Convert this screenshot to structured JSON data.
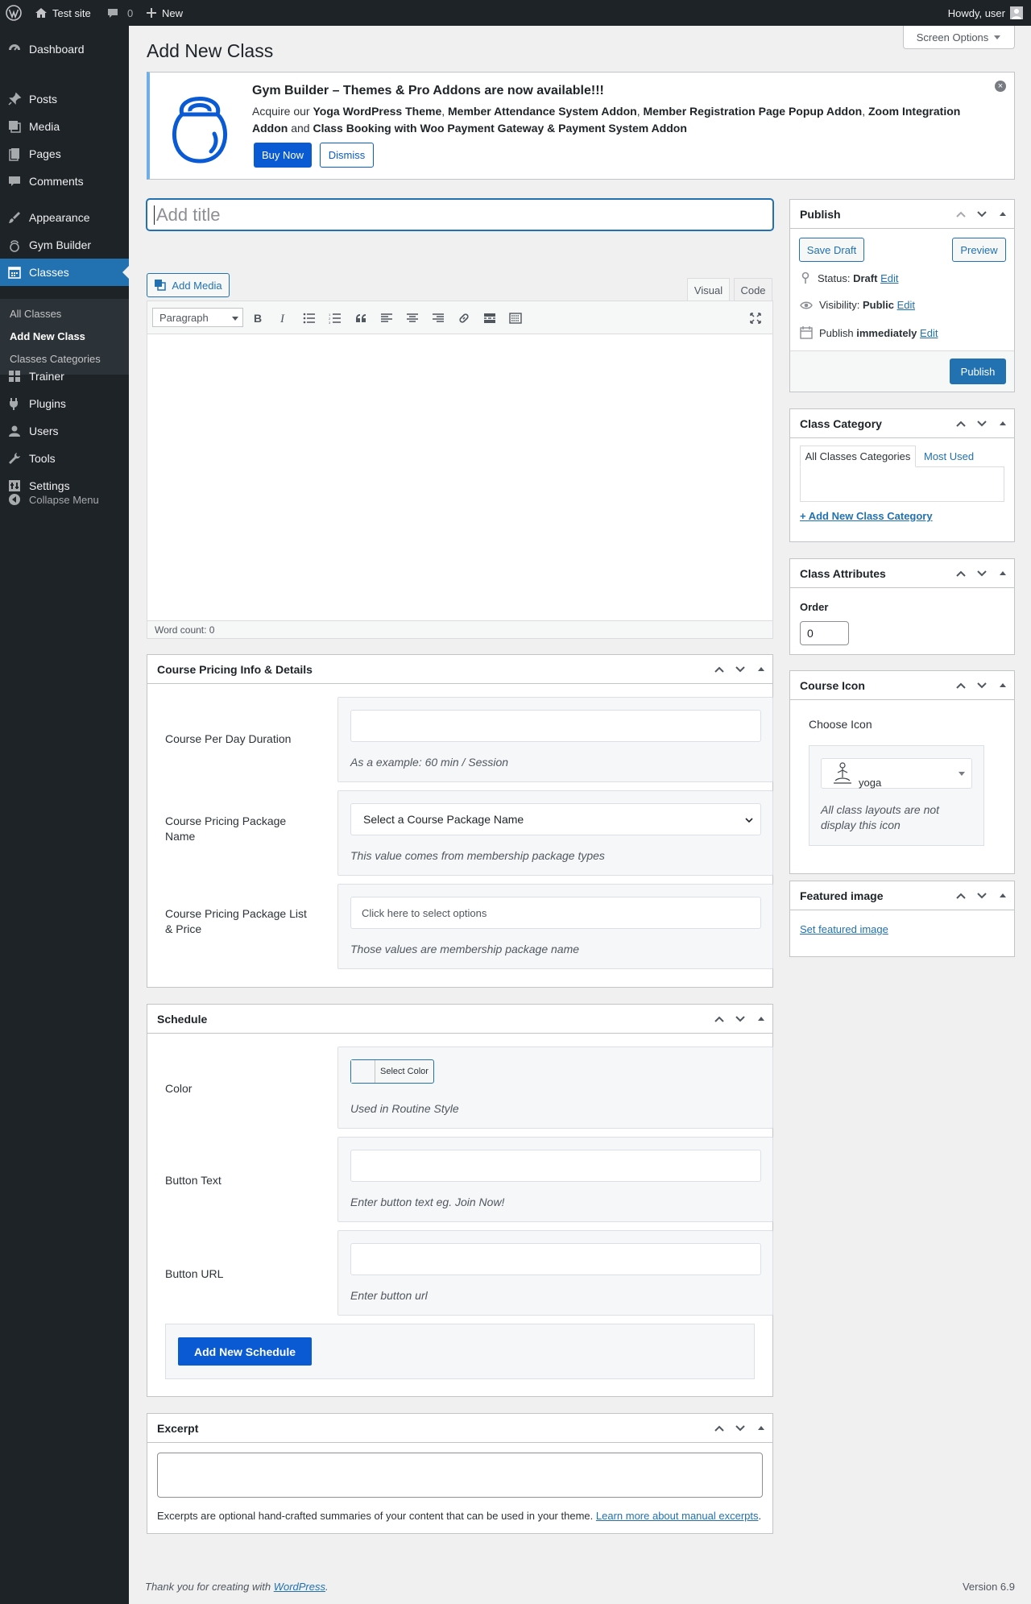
{
  "adminbar": {
    "site_name": "Test site",
    "comments_count": "0",
    "new_label": "New",
    "howdy": "Howdy, user"
  },
  "sidebar": {
    "items": [
      {
        "label": "Dashboard",
        "icon": "dashboard-icon"
      },
      {
        "label": "Posts",
        "icon": "pin-icon"
      },
      {
        "label": "Media",
        "icon": "media-icon"
      },
      {
        "label": "Pages",
        "icon": "page-icon"
      },
      {
        "label": "Comments",
        "icon": "comment-icon"
      },
      {
        "label": "Appearance",
        "icon": "brush-icon"
      },
      {
        "label": "Gym Builder",
        "icon": "kettlebell-icon"
      },
      {
        "label": "Classes",
        "icon": "calendar-icon"
      },
      {
        "label": "Trainer",
        "icon": "grid-icon"
      },
      {
        "label": "Plugins",
        "icon": "plug-icon"
      },
      {
        "label": "Users",
        "icon": "user-icon"
      },
      {
        "label": "Tools",
        "icon": "wrench-icon"
      },
      {
        "label": "Settings",
        "icon": "settings-icon"
      }
    ],
    "submenu": [
      "All Classes",
      "Add New Class",
      "Classes Categories"
    ],
    "collapse": "Collapse Menu"
  },
  "page": {
    "title": "Add New Class",
    "screen_options": "Screen Options"
  },
  "notice": {
    "title": "Gym Builder – Themes & Pro Addons are now available!!!",
    "text_1": "Acquire our ",
    "bold_1": "Yoga WordPress Theme",
    "sep_1": ", ",
    "bold_2": "Member Attendance System Addon",
    "sep_2": ", ",
    "bold_3": "Member Registration Page Popup Addon",
    "sep_3": ", ",
    "bold_4": "Zoom Integration Addon",
    "sep_4": " and ",
    "bold_5": "Class Booking with Woo Payment Gateway & Payment System Addon",
    "buy_now": "Buy Now",
    "dismiss": "Dismiss"
  },
  "editor": {
    "title_placeholder": "Add title",
    "add_media": "Add Media",
    "tab_visual": "Visual",
    "tab_code": "Code",
    "paragraph": "Paragraph",
    "word_count": "Word count: 0"
  },
  "pricing": {
    "heading": "Course Pricing Info & Details",
    "duration_label": "Course Per Day Duration",
    "duration_desc": "As a example: 60 min / Session",
    "package_label": "Course Pricing Package Name",
    "package_select": "Select a Course Package Name",
    "package_desc": "This value comes from membership package types",
    "list_label": "Course Pricing Package List & Price",
    "list_placeholder": "Click here to select options",
    "list_desc": "Those values are membership package name"
  },
  "schedule": {
    "heading": "Schedule",
    "color_label": "Color",
    "color_button": "Select Color",
    "color_desc": "Used in Routine Style",
    "btn_text_label": "Button Text",
    "btn_text_desc": "Enter button text eg. Join Now!",
    "btn_url_label": "Button URL",
    "btn_url_desc": "Enter button url",
    "add_schedule": "Add New Schedule"
  },
  "excerpt": {
    "heading": "Excerpt",
    "desc": "Excerpts are optional hand-crafted summaries of your content that can be used in your theme.",
    "link": "Learn more about manual excerpts",
    "period": "."
  },
  "publish": {
    "heading": "Publish",
    "save_draft": "Save Draft",
    "preview": "Preview",
    "status_label": "Status:",
    "status_value": "Draft",
    "visibility_label": "Visibility:",
    "visibility_value": "Public",
    "publish_label": "Publish",
    "publish_value": "immediately",
    "edit": "Edit",
    "publish_button": "Publish"
  },
  "class_category": {
    "heading": "Class Category",
    "tab_all": "All Classes Categories",
    "tab_most": "Most Used",
    "add_new": "+ Add New Class Category"
  },
  "class_attributes": {
    "heading": "Class Attributes",
    "order_label": "Order",
    "order_value": "0"
  },
  "course_icon": {
    "heading": "Course Icon",
    "choose": "Choose Icon",
    "selected": "yoga",
    "desc": "All class layouts are not display this icon"
  },
  "featured": {
    "heading": "Featured image",
    "link": "Set featured image"
  },
  "footer": {
    "thanks": "Thank you for creating with ",
    "wp": "WordPress",
    "period": ".",
    "version": "Version 6.9"
  },
  "colors": {
    "admin_dark": "#1d2327",
    "accent": "#2271b1",
    "notice_button": "#0a5ad4"
  }
}
